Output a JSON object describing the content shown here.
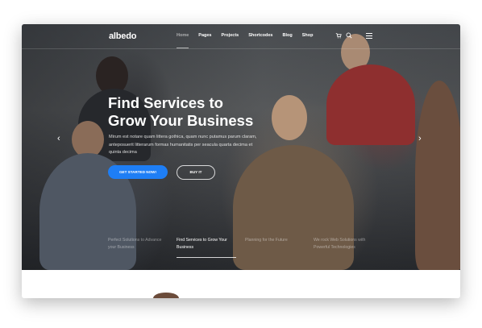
{
  "nav": {
    "logo": "albedo",
    "menu": [
      {
        "label": "Home",
        "active": true
      },
      {
        "label": "Pages",
        "active": false
      },
      {
        "label": "Projects",
        "active": false
      },
      {
        "label": "Shortcodes",
        "active": false
      },
      {
        "label": "Blog",
        "active": false
      },
      {
        "label": "Shop",
        "active": false
      }
    ],
    "icons": [
      "cart-icon",
      "search-icon",
      "menu-icon"
    ]
  },
  "hero": {
    "headline_line1": "Find Services to",
    "headline_line2": "Grow Your Business",
    "subtext": "Mirum est notare quam littera gothica, quam nunc putamus parum claram, anteposuerit litterarum formas humanitatis per seacula quarta decima et quinta decima",
    "primary_button": "GET STARTED NOW!",
    "secondary_button": "BUY IT",
    "prev_arrow": "‹",
    "next_arrow": "›",
    "slides": [
      {
        "label": "Perfect Solutions to Advance your Business",
        "active": false
      },
      {
        "label": "Find Services to Grow Your Business",
        "active": true
      },
      {
        "label": "Planning for the Future",
        "active": false
      },
      {
        "label": "We rock Web Solutions with Powerful Technologies",
        "active": false
      }
    ]
  },
  "colors": {
    "accent": "#1e7ef5"
  }
}
